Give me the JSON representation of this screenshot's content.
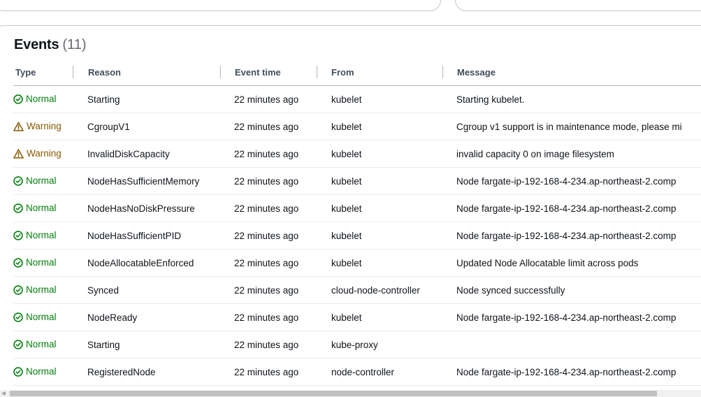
{
  "panel": {
    "title": "Events",
    "count": "(11)"
  },
  "columns": {
    "type": "Type",
    "reason": "Reason",
    "event_time": "Event time",
    "from": "From",
    "message": "Message"
  },
  "colors": {
    "normal": "#037f0c",
    "warning": "#855900",
    "header_text": "#414d5c",
    "border": "#c6c6cd"
  },
  "events": [
    {
      "type": "Normal",
      "icon": "status-success-icon",
      "reason": "Starting",
      "time": "22 minutes ago",
      "from": "kubelet",
      "message": "Starting kubelet."
    },
    {
      "type": "Warning",
      "icon": "status-warning-icon",
      "reason": "CgroupV1",
      "time": "22 minutes ago",
      "from": "kubelet",
      "message": "Cgroup v1 support is in maintenance mode, please mi"
    },
    {
      "type": "Warning",
      "icon": "status-warning-icon",
      "reason": "InvalidDiskCapacity",
      "time": "22 minutes ago",
      "from": "kubelet",
      "message": "invalid capacity 0 on image filesystem"
    },
    {
      "type": "Normal",
      "icon": "status-success-icon",
      "reason": "NodeHasSufficientMemory",
      "time": "22 minutes ago",
      "from": "kubelet",
      "message": "Node fargate-ip-192-168-4-234.ap-northeast-2.comp"
    },
    {
      "type": "Normal",
      "icon": "status-success-icon",
      "reason": "NodeHasNoDiskPressure",
      "time": "22 minutes ago",
      "from": "kubelet",
      "message": "Node fargate-ip-192-168-4-234.ap-northeast-2.comp"
    },
    {
      "type": "Normal",
      "icon": "status-success-icon",
      "reason": "NodeHasSufficientPID",
      "time": "22 minutes ago",
      "from": "kubelet",
      "message": "Node fargate-ip-192-168-4-234.ap-northeast-2.comp"
    },
    {
      "type": "Normal",
      "icon": "status-success-icon",
      "reason": "NodeAllocatableEnforced",
      "time": "22 minutes ago",
      "from": "kubelet",
      "message": "Updated Node Allocatable limit across pods"
    },
    {
      "type": "Normal",
      "icon": "status-success-icon",
      "reason": "Synced",
      "time": "22 minutes ago",
      "from": "cloud-node-controller",
      "message": "Node synced successfully"
    },
    {
      "type": "Normal",
      "icon": "status-success-icon",
      "reason": "NodeReady",
      "time": "22 minutes ago",
      "from": "kubelet",
      "message": "Node fargate-ip-192-168-4-234.ap-northeast-2.comp"
    },
    {
      "type": "Normal",
      "icon": "status-success-icon",
      "reason": "Starting",
      "time": "22 minutes ago",
      "from": "kube-proxy",
      "message": ""
    },
    {
      "type": "Normal",
      "icon": "status-success-icon",
      "reason": "RegisteredNode",
      "time": "22 minutes ago",
      "from": "node-controller",
      "message": "Node fargate-ip-192-168-4-234.ap-northeast-2.comp"
    }
  ]
}
